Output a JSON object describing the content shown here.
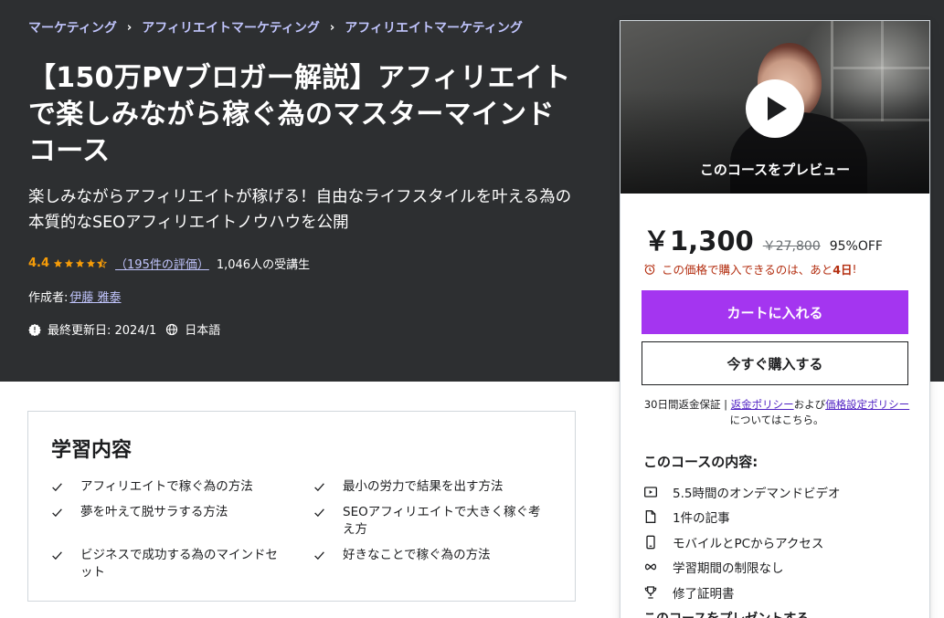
{
  "breadcrumb": [
    "マーケティング",
    "アフィリエイトマーケティング",
    "アフィリエイトマーケティング"
  ],
  "breadcrumb_separator": "›",
  "course": {
    "title": "【150万PVブロガー解説】アフィリエイトで楽しみながら稼ぐ為のマスターマインドコース",
    "subtitle": "楽しみながらアフィリエイトが稼げる！自由なライフスタイルを叶える為の本質的なSEOアフィリエイトノウハウを公開",
    "rating": "4.4",
    "rating_stars": 4.4,
    "rating_count": "（195件の評価）",
    "students": "1,046人の受講生",
    "author_label": "作成者:",
    "author": "伊藤 雅泰",
    "updated": "最終更新日: 2024/1",
    "language": "日本語"
  },
  "sidebar": {
    "preview_label": "このコースをプレビュー",
    "price": "￥1,300",
    "original_price": "￥27,800",
    "discount": "95%OFF",
    "timer_text": "この価格で購入できるのは、あと",
    "timer_days": "4日",
    "timer_suffix": "!",
    "cart_button": "カートに入れる",
    "buy_button": "今すぐ購入する",
    "guarantee_text": "30日間返金保証",
    "guarantee_sep": " | ",
    "refund_link": "返金ポリシー",
    "and_text": "および",
    "pricing_link": "価格設定ポリシー",
    "suffix_text": "についてはこちら。",
    "includes_title": "このコースの内容:",
    "includes": [
      {
        "icon": "video-icon",
        "text": "5.5時間のオンデマンドビデオ"
      },
      {
        "icon": "article-icon",
        "text": "1件の記事"
      },
      {
        "icon": "mobile-icon",
        "text": "モバイルとPCからアクセス"
      },
      {
        "icon": "infinity-icon",
        "text": "学習期間の制限なし"
      },
      {
        "icon": "trophy-icon",
        "text": "修了証明書"
      }
    ],
    "gift_link": "このコースをプレゼントする"
  },
  "learn": {
    "title": "学習内容",
    "items": [
      "アフィリエイトで稼ぐ為の方法",
      "最小の労力で結果を出す方法",
      "夢を叶えて脱サラする方法",
      "SEOアフィリエイトで大きく稼ぐ考え方",
      "ビジネスで成功する為のマインドセット",
      "好きなことで稼ぐ為の方法"
    ]
  },
  "colors": {
    "hero_bg": "#2d2f31",
    "link_light": "#c0c4fc",
    "rating": "#f69c08",
    "cta": "#a435f0",
    "timer": "#b32d0f",
    "link_dark": "#5022c3"
  }
}
